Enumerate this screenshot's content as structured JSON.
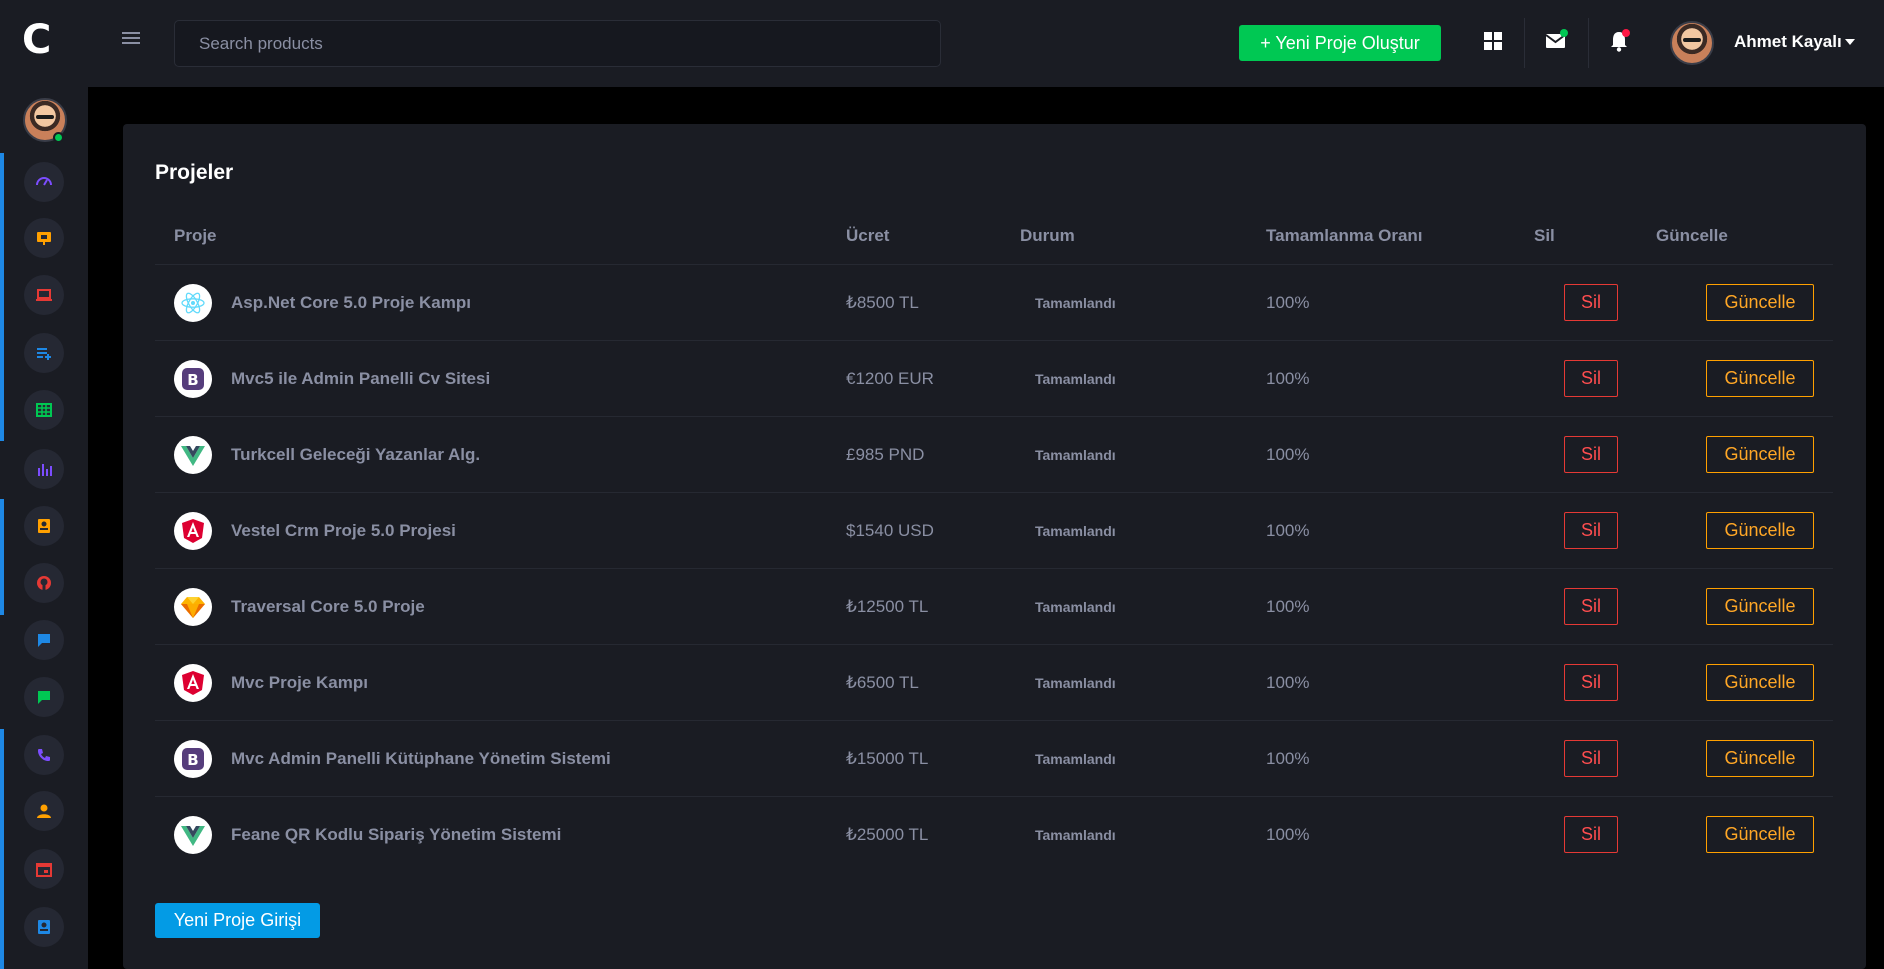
{
  "app": {
    "logo": "C"
  },
  "search": {
    "placeholder": "Search products"
  },
  "header": {
    "new_project_label": "+ Yeni Proje Oluştur",
    "username": "Ahmet Kayalı"
  },
  "sidebar": {
    "items": [
      {
        "icon": "dashboard-gauge-icon",
        "color": "#7c4dff"
      },
      {
        "icon": "presentation-icon",
        "color": "#ffa000"
      },
      {
        "icon": "laptop-icon",
        "color": "#e53935"
      },
      {
        "icon": "playlist-add-icon",
        "color": "#1e88e5"
      },
      {
        "icon": "table-grid-icon",
        "color": "#00c853"
      },
      {
        "icon": "bar-chart-icon",
        "color": "#7c4dff"
      },
      {
        "icon": "contact-card-icon",
        "color": "#ffa000"
      },
      {
        "icon": "github-icon",
        "color": "#e53935"
      },
      {
        "icon": "chat-icon",
        "color": "#1e88e5"
      },
      {
        "icon": "message-icon",
        "color": "#00c853"
      },
      {
        "icon": "phone-icon",
        "color": "#7c4dff"
      },
      {
        "icon": "user-icon",
        "color": "#ffa000"
      },
      {
        "icon": "calendar-icon",
        "color": "#e53935"
      },
      {
        "icon": "contacts-icon",
        "color": "#1e88e5"
      }
    ]
  },
  "main": {
    "title": "Projeler",
    "columns": [
      "Proje",
      "Ücret",
      "Durum",
      "Tamamlanma Oranı",
      "Sil",
      "Güncelle"
    ],
    "rows": [
      {
        "icon": "react-icon",
        "name": "Asp.Net Core 5.0 Proje Kampı",
        "price": "₺8500 TL",
        "status": "Tamamlandı",
        "rate": "100%",
        "delete": "Sil",
        "update": "Güncelle"
      },
      {
        "icon": "bootstrap-icon",
        "name": "Mvc5 ile Admin Panelli Cv Sitesi",
        "price": "€1200 EUR",
        "status": "Tamamlandı",
        "rate": "100%",
        "delete": "Sil",
        "update": "Güncelle"
      },
      {
        "icon": "vue-icon",
        "name": "Turkcell Geleceği Yazanlar Alg.",
        "price": "£985 PND",
        "status": "Tamamlandı",
        "rate": "100%",
        "delete": "Sil",
        "update": "Güncelle"
      },
      {
        "icon": "angular-icon",
        "name": "Vestel Crm Proje 5.0 Projesi",
        "price": "$1540 USD",
        "status": "Tamamlandı",
        "rate": "100%",
        "delete": "Sil",
        "update": "Güncelle"
      },
      {
        "icon": "sketch-icon",
        "name": "Traversal Core 5.0 Proje",
        "price": "₺12500 TL",
        "status": "Tamamlandı",
        "rate": "100%",
        "delete": "Sil",
        "update": "Güncelle"
      },
      {
        "icon": "angular-icon",
        "name": "Mvc Proje Kampı",
        "price": "₺6500 TL",
        "status": "Tamamlandı",
        "rate": "100%",
        "delete": "Sil",
        "update": "Güncelle"
      },
      {
        "icon": "bootstrap-icon",
        "name": "Mvc Admin Panelli Kütüphane Yönetim Sistemi",
        "price": "₺15000 TL",
        "status": "Tamamlandı",
        "rate": "100%",
        "delete": "Sil",
        "update": "Güncelle"
      },
      {
        "icon": "vue-icon",
        "name": "Feane QR Kodlu Sipariş Yönetim Sistemi",
        "price": "₺25000 TL",
        "status": "Tamamlandı",
        "rate": "100%",
        "delete": "Sil",
        "update": "Güncelle"
      }
    ],
    "entry_button_label": "Yeni Proje Girişi"
  }
}
